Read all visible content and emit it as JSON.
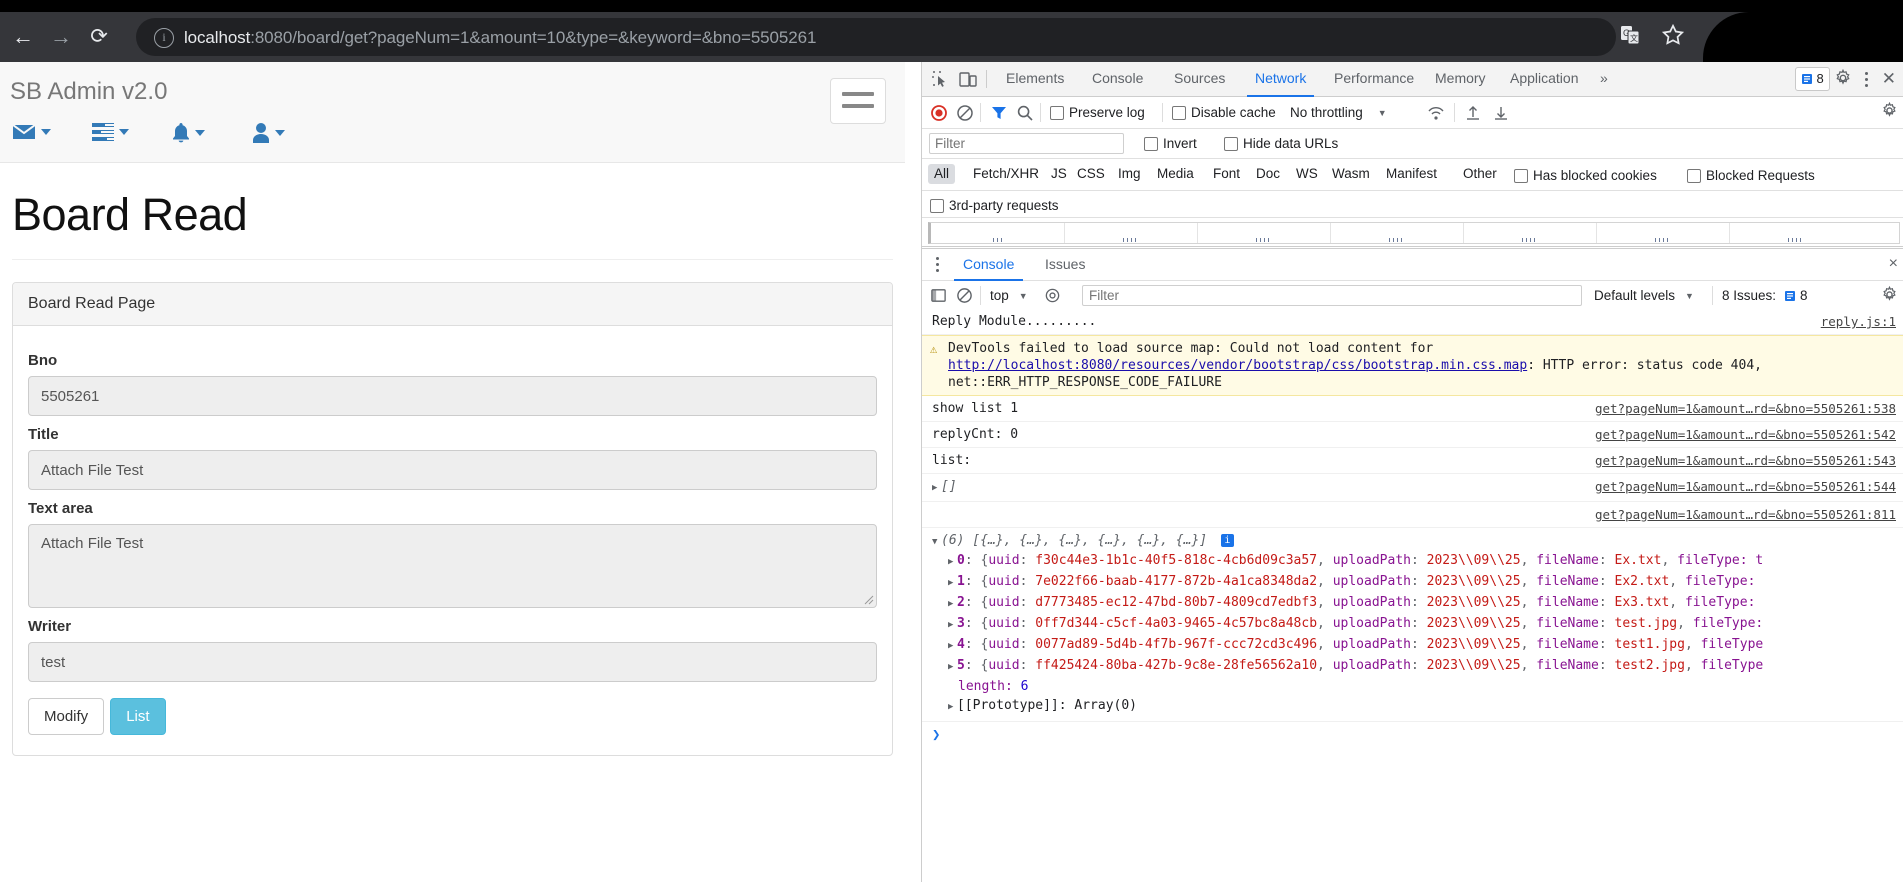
{
  "browser": {
    "url_prefix": "localhost",
    "url_rest": ":8080/board/get?pageNum=1&amount=10&type=&keyword=&bno=5505261",
    "back_glyph": "←",
    "forward_glyph": "→",
    "reload_glyph": "⟳",
    "info_glyph": "i",
    "icons": {
      "translate": "translate-icon",
      "bookmark": "star-icon"
    }
  },
  "page": {
    "brand": "SB Admin v2.0",
    "nav_icons": [
      {
        "name": "messages-dropdown",
        "icon": "envelope-icon"
      },
      {
        "name": "tasks-dropdown",
        "icon": "tasks-icon"
      },
      {
        "name": "alerts-dropdown",
        "icon": "bell-icon"
      },
      {
        "name": "user-dropdown",
        "icon": "user-icon"
      }
    ],
    "title": "Board Read",
    "panel_heading": "Board Read Page",
    "fields": [
      {
        "label": "Bno",
        "value": "5505261"
      },
      {
        "label": "Title",
        "value": "Attach File Test"
      },
      {
        "label": "Text area",
        "value": "Attach File Test"
      },
      {
        "label": "Writer",
        "value": "test"
      }
    ],
    "buttons": {
      "modify": "Modify",
      "list": "List"
    },
    "accent": "#5bc0de"
  },
  "devtools": {
    "tabs": [
      {
        "label": "Elements",
        "active": false
      },
      {
        "label": "Console",
        "active": false
      },
      {
        "label": "Sources",
        "active": false
      },
      {
        "label": "Network",
        "active": true
      },
      {
        "label": "Performance",
        "active": false
      },
      {
        "label": "Memory",
        "active": false
      },
      {
        "label": "Application",
        "active": false
      }
    ],
    "more_tabs_glyph": "»",
    "issues_count": "8",
    "network_toolbar": {
      "preserve_log": "Preserve log",
      "disable_cache": "Disable cache",
      "throttling": "No throttling",
      "caret": "▼"
    },
    "filter_placeholder": "Filter",
    "invert": "Invert",
    "hide_data_urls": "Hide data URLs",
    "type_filters": [
      "All",
      "Fetch/XHR",
      "JS",
      "CSS",
      "Img",
      "Media",
      "Font",
      "Doc",
      "WS",
      "Wasm",
      "Manifest",
      "Other"
    ],
    "selected_type": "All",
    "has_blocked_cookies": "Has blocked cookies",
    "blocked_requests": "Blocked Requests",
    "third_party": "3rd-party requests",
    "drawer": {
      "tabs": [
        {
          "label": "Console",
          "active": true
        },
        {
          "label": "Issues",
          "active": false
        }
      ],
      "context": "top",
      "context_caret": "▼",
      "filter_placeholder": "Filter",
      "levels": "Default levels",
      "levels_caret": "▼",
      "issues_label": "8 Issues:",
      "issues_count": "8",
      "close_glyph": "×",
      "prompt": "❯"
    },
    "console_logs": [
      {
        "kind": "plain",
        "text": "Reply Module.........",
        "source": "reply.js:1"
      },
      {
        "kind": "warning",
        "prefix": "DevTools failed to load source map: Could not load content for ",
        "link": "http://localhost:8080/resources/vendor/bootstrap/css/bootstrap.min.css.map",
        "suffix": ": HTTP error: status code 404, net::ERR_HTTP_RESPONSE_CODE_FAILURE",
        "source": ""
      },
      {
        "kind": "plain",
        "text": "show list 1",
        "source": "get?pageNum=1&amount…rd=&bno=5505261:538"
      },
      {
        "kind": "plain",
        "text": "replyCnt: 0",
        "source": "get?pageNum=1&amount…rd=&bno=5505261:542"
      },
      {
        "kind": "plain",
        "text": "list:",
        "source": "get?pageNum=1&amount…rd=&bno=5505261:543"
      },
      {
        "kind": "empty-array",
        "text": "[]",
        "source": "get?pageNum=1&amount…rd=&bno=5505261:544"
      },
      {
        "kind": "blank",
        "text": "",
        "source": "get?pageNum=1&amount…rd=&bno=5505261:811"
      }
    ],
    "array_log": {
      "header": "(6) [{…}, {…}, {…}, {…}, {…}, {…}]",
      "entries": [
        {
          "index": "0",
          "uuid": "f30c44e3-1b1c-40f5-818c-4cb6d09c3a57",
          "uploadPath": "2023\\\\09\\\\25",
          "fileName": "Ex.txt",
          "tail": "fileType: t"
        },
        {
          "index": "1",
          "uuid": "7e022f66-baab-4177-872b-4a1ca8348da2",
          "uploadPath": "2023\\\\09\\\\25",
          "fileName": "Ex2.txt",
          "tail": "fileType:"
        },
        {
          "index": "2",
          "uuid": "d7773485-ec12-47bd-80b7-4809cd7edbf3",
          "uploadPath": "2023\\\\09\\\\25",
          "fileName": "Ex3.txt",
          "tail": "fileType:"
        },
        {
          "index": "3",
          "uuid": "0ff7d344-c5cf-4a03-9465-4c57bc8a48cb",
          "uploadPath": "2023\\\\09\\\\25",
          "fileName": "test.jpg",
          "tail": "fileType:"
        },
        {
          "index": "4",
          "uuid": "0077ad89-5d4b-4f7b-967f-ccc72cd3c496",
          "uploadPath": "2023\\\\09\\\\25",
          "fileName": "test1.jpg",
          "tail": "fileType"
        },
        {
          "index": "5",
          "uuid": "ff425424-80ba-427b-9c8e-28fe56562a10",
          "uploadPath": "2023\\\\09\\\\25",
          "fileName": "test2.jpg",
          "tail": "fileType"
        }
      ],
      "length_label": "length:",
      "length_value": "6",
      "prototype": "[[Prototype]]: Array(0)"
    }
  }
}
